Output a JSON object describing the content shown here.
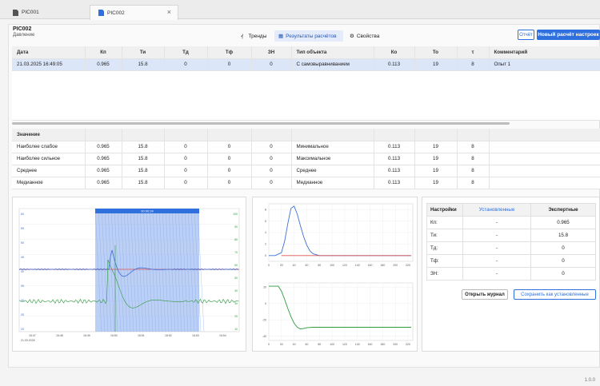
{
  "tabs": [
    {
      "label": "PIC001"
    },
    {
      "label": "PIC002"
    }
  ],
  "header": {
    "title": "PIC002",
    "subtitle": "Давление"
  },
  "views": {
    "trends": "Тренды",
    "results": "Результаты расчётов",
    "properties": "Свойства"
  },
  "buttons": {
    "report": "Отчёт",
    "new_calc": "Новый расчёт настроек",
    "open_log": "Открыть журнал",
    "save_as_set": "Сохранить как установленные"
  },
  "results_table": {
    "columns": [
      "Дата",
      "Кп",
      "Ти",
      "Тд",
      "Тф",
      "ЗН",
      "Тип объекта",
      "Ко",
      "То",
      "τ",
      "Комментарий"
    ],
    "rows": [
      [
        "21.03.2025 16:49:05",
        "0.965",
        "15.8",
        "0",
        "0",
        "0",
        "С самовыравниванием",
        "0.113",
        "19",
        "8",
        "Опыт 1"
      ]
    ]
  },
  "values_table": {
    "columns": [
      "Значение",
      "",
      "",
      "",
      "",
      "",
      "",
      "",
      "",
      "",
      ""
    ],
    "rows": [
      [
        "Наиболее слабое",
        "0.965",
        "15.8",
        "0",
        "0",
        "0",
        "Минимальное",
        "0.113",
        "19",
        "8",
        ""
      ],
      [
        "Наиболее сильное",
        "0.965",
        "15.8",
        "0",
        "0",
        "0",
        "Максимальное",
        "0.113",
        "19",
        "8",
        ""
      ],
      [
        "Среднее",
        "0.965",
        "15.8",
        "0",
        "0",
        "0",
        "Среднее",
        "0.113",
        "19",
        "8",
        ""
      ],
      [
        "Медианное",
        "0.965",
        "15.8",
        "0",
        "0",
        "0",
        "Медианное",
        "0.113",
        "19",
        "8",
        ""
      ]
    ]
  },
  "trend_chart": {
    "selection_label": "00:00:24",
    "x_ticks": [
      "16:47",
      "16:48",
      "16:49",
      "16:50",
      "16:51",
      "16:52",
      "16:53",
      "16:54"
    ],
    "date_label": "21.03.2025",
    "left_ticks": [
      "60",
      "55",
      "50",
      "45",
      "40",
      "35",
      "30",
      "25",
      "20"
    ],
    "right_ticks": [
      "100",
      "90",
      "80",
      "70",
      "60",
      "50",
      "40",
      "30",
      "20",
      "10"
    ],
    "colors": {
      "pv": "#3d6fd9",
      "sp": "#e05353",
      "out": "#2e9a3e",
      "selection": "#8fb0ee"
    }
  },
  "chart_data": [
    {
      "type": "line",
      "x_ticks": [
        "0",
        "20",
        "40",
        "60",
        "80",
        "100",
        "120",
        "140",
        "160",
        "180",
        "200",
        "220"
      ],
      "y_ticks": [
        "8",
        "6",
        "4",
        "2",
        "0"
      ],
      "series": [
        {
          "color": "#3d6fd9",
          "x": [
            0,
            10,
            20,
            25,
            30,
            35,
            40,
            45,
            50,
            55,
            60,
            65,
            70,
            80,
            90,
            100,
            120,
            150,
            180,
            225
          ],
          "values": [
            0,
            0,
            0.5,
            2.5,
            5.5,
            8.2,
            8.6,
            7.2,
            5.2,
            3.3,
            1.8,
            0.8,
            0.3,
            0,
            0,
            0,
            0,
            0,
            0,
            0
          ]
        },
        {
          "color": "#e05353",
          "x": [
            20,
            225
          ],
          "values": [
            0,
            0
          ]
        }
      ]
    },
    {
      "type": "line",
      "x_ticks": [
        "0",
        "20",
        "40",
        "60",
        "80",
        "100",
        "120",
        "140",
        "160",
        "180",
        "200",
        "220"
      ],
      "y_ticks": [
        "20",
        "0",
        "-20",
        "-40"
      ],
      "series": [
        {
          "color": "#2e9a3e",
          "x": [
            0,
            5,
            10,
            15,
            20,
            25,
            30,
            35,
            40,
            45,
            50,
            55,
            60,
            70,
            80,
            100,
            140,
            180,
            225
          ],
          "values": [
            21,
            21,
            21,
            21,
            15,
            5,
            -6,
            -16,
            -24,
            -29,
            -31,
            -30.5,
            -29.5,
            -29,
            -29,
            -29,
            -29,
            -29,
            -29
          ]
        }
      ]
    }
  ],
  "settings": {
    "columns": [
      "Настройки",
      "Установленные",
      "Экспертные"
    ],
    "rows": [
      [
        "Кп:",
        "-",
        "0.965"
      ],
      [
        "Ти:",
        "-",
        "15.8"
      ],
      [
        "Тд:",
        "-",
        "0"
      ],
      [
        "Тф:",
        "-",
        "0"
      ],
      [
        "ЗН:",
        "-",
        "0"
      ]
    ],
    "installed_color": "#2f6fde"
  },
  "version": "1.0.0"
}
